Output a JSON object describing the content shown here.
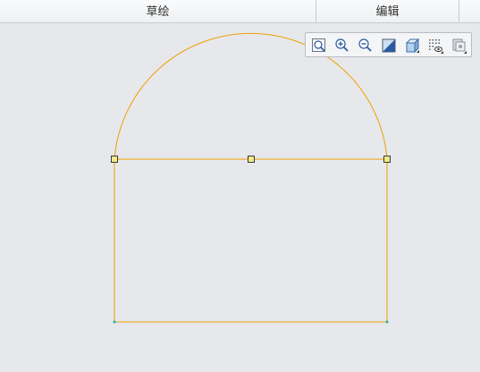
{
  "tabs": {
    "sketch": "草绘",
    "edit": "编辑"
  },
  "toolbar": {
    "icons": [
      "zoom-fit-icon",
      "zoom-in-icon",
      "zoom-out-icon",
      "repaint-icon",
      "display-style-icon",
      "sketcher-display-filter-icon",
      "sketch-view-icon"
    ]
  },
  "colors": {
    "sketch_line": "#f0a000",
    "vertex_fill": "#f2ea8a",
    "vertex_stroke": "#3a3a3a",
    "endpoint": "#19b3b3",
    "canvas_bg": "#e6e8eb"
  }
}
